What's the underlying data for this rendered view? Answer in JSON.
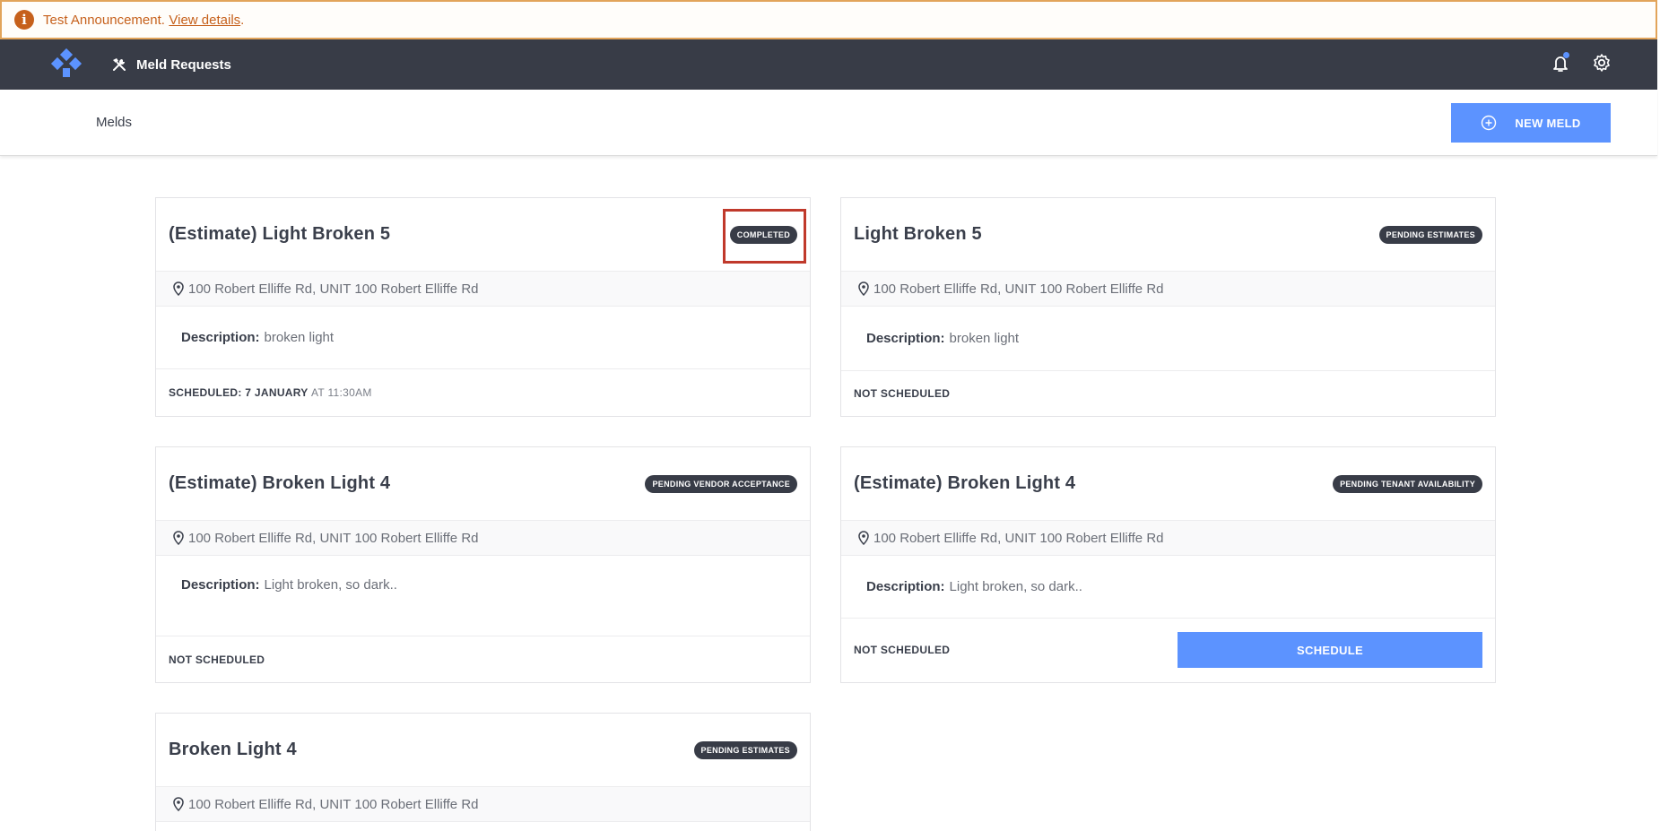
{
  "announcement": {
    "icon": "info-icon",
    "message": "Test Announcement.",
    "link": "View details",
    "trailing": "."
  },
  "nav": {
    "logo": "meld-logo",
    "item_label": "Meld Requests",
    "item_icon": "tools-icon",
    "icons": [
      "bell-icon",
      "gear-icon"
    ]
  },
  "subheader": {
    "title": "Melds",
    "new_button": "NEW MELD"
  },
  "melds": [
    {
      "title": "(Estimate) Light Broken 5",
      "status": "COMPLETED",
      "address": "100 Robert Elliffe Rd, UNIT 100 Robert Elliffe Rd",
      "description_label": "Description:",
      "description": "broken light",
      "schedule_label": "SCHEDULED: 7 JANUARY",
      "schedule_time": "AT 11:30AM"
    },
    {
      "title": "Light Broken 5",
      "status": "PENDING ESTIMATES",
      "address": "100 Robert Elliffe Rd, UNIT 100 Robert Elliffe Rd",
      "description_label": "Description:",
      "description": "broken light",
      "schedule_label": "NOT SCHEDULED"
    },
    {
      "title": "(Estimate) Broken Light 4",
      "status": "PENDING VENDOR ACCEPTANCE",
      "address": "100 Robert Elliffe Rd, UNIT 100 Robert Elliffe Rd",
      "description_label": "Description:",
      "description": "Light broken, so dark..",
      "schedule_label": "NOT SCHEDULED"
    },
    {
      "title": "(Estimate) Broken Light 4",
      "status": "PENDING TENANT AVAILABILITY",
      "address": "100 Robert Elliffe Rd, UNIT 100 Robert Elliffe Rd",
      "description_label": "Description:",
      "description": "Light broken, so dark..",
      "schedule_label": "NOT SCHEDULED",
      "schedule_button": "SCHEDULE"
    },
    {
      "title": "Broken Light 4",
      "status": "PENDING ESTIMATES",
      "address": "100 Robert Elliffe Rd, UNIT 100 Robert Elliffe Rd"
    }
  ],
  "colors": {
    "nav_bg": "#383c47",
    "accent": "#5c93ff",
    "announcement": "#c6601b",
    "highlight": "#c0392b"
  }
}
